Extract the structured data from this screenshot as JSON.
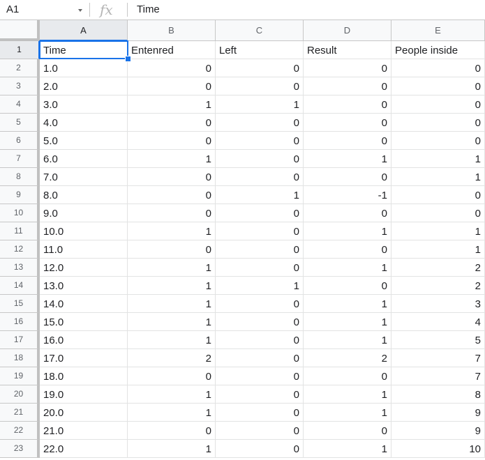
{
  "formula_bar": {
    "cell_ref": "A1",
    "fx_symbol": "fx",
    "value": "Time"
  },
  "columns": [
    "A",
    "B",
    "C",
    "D",
    "E"
  ],
  "rows": [
    [
      "Time",
      "Entenred",
      "Left",
      "Result",
      "People inside"
    ],
    [
      "1.0",
      "0",
      "0",
      "0",
      "0"
    ],
    [
      "2.0",
      "0",
      "0",
      "0",
      "0"
    ],
    [
      "3.0",
      "1",
      "1",
      "0",
      "0"
    ],
    [
      "4.0",
      "0",
      "0",
      "0",
      "0"
    ],
    [
      "5.0",
      "0",
      "0",
      "0",
      "0"
    ],
    [
      "6.0",
      "1",
      "0",
      "1",
      "1"
    ],
    [
      "7.0",
      "0",
      "0",
      "0",
      "1"
    ],
    [
      "8.0",
      "0",
      "1",
      "-1",
      "0"
    ],
    [
      "9.0",
      "0",
      "0",
      "0",
      "0"
    ],
    [
      "10.0",
      "1",
      "0",
      "1",
      "1"
    ],
    [
      "11.0",
      "0",
      "0",
      "0",
      "1"
    ],
    [
      "12.0",
      "1",
      "0",
      "1",
      "2"
    ],
    [
      "13.0",
      "1",
      "1",
      "0",
      "2"
    ],
    [
      "14.0",
      "1",
      "0",
      "1",
      "3"
    ],
    [
      "15.0",
      "1",
      "0",
      "1",
      "4"
    ],
    [
      "16.0",
      "1",
      "0",
      "1",
      "5"
    ],
    [
      "17.0",
      "2",
      "0",
      "2",
      "7"
    ],
    [
      "18.0",
      "0",
      "0",
      "0",
      "7"
    ],
    [
      "19.0",
      "1",
      "0",
      "1",
      "8"
    ],
    [
      "20.0",
      "1",
      "0",
      "1",
      "9"
    ],
    [
      "21.0",
      "0",
      "0",
      "0",
      "9"
    ],
    [
      "22.0",
      "1",
      "0",
      "1",
      "10"
    ]
  ],
  "row_numbers": [
    "1",
    "2",
    "3",
    "4",
    "5",
    "6",
    "7",
    "8",
    "9",
    "10",
    "11",
    "12",
    "13",
    "14",
    "15",
    "16",
    "17",
    "18",
    "19",
    "20",
    "21",
    "22",
    "23"
  ],
  "active_cell": "A1",
  "colors": {
    "selection": "#1a73e8",
    "header_bg": "#f8f9fa",
    "gridline": "#e2e3e3"
  }
}
